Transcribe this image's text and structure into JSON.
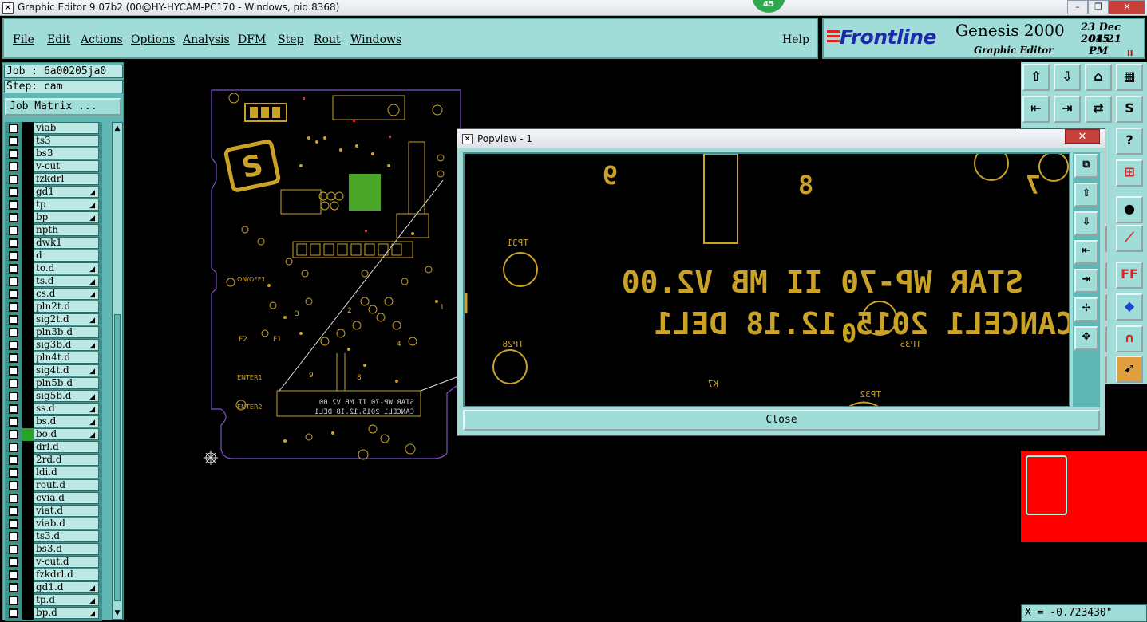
{
  "window": {
    "title": "Graphic Editor 9.07b2 (00@HY-HYCAM-PC170 - Windows, pid:8368)",
    "badge": "45",
    "minimize": "–",
    "maximize": "❐",
    "close": "✕"
  },
  "menu": {
    "items": [
      "File",
      "Edit",
      "Actions",
      "Options",
      "Analysis",
      "DFM",
      "Step",
      "Rout",
      "Windows"
    ],
    "help": "Help"
  },
  "brand": {
    "logo": "Frontline",
    "product": "Genesis 2000",
    "editor": "Graphic Editor",
    "date": "23 Dec 2015",
    "time": "04:21 PM",
    "pause": "II"
  },
  "left": {
    "job": "Job : 6a00205ja0",
    "step": "Step: cam",
    "job_matrix": "Job Matrix ..."
  },
  "layers": [
    {
      "name": "viab",
      "flag": ""
    },
    {
      "name": "ts3",
      "flag": ""
    },
    {
      "name": "bs3",
      "flag": ""
    },
    {
      "name": "v-cut",
      "flag": ""
    },
    {
      "name": "fzkdrl",
      "flag": ""
    },
    {
      "name": "gd1",
      "flag": "◢"
    },
    {
      "name": "tp",
      "flag": "◢"
    },
    {
      "name": "bp",
      "flag": "◢"
    },
    {
      "name": "npth",
      "flag": ""
    },
    {
      "name": "dwk1",
      "flag": ""
    },
    {
      "name": "d",
      "flag": ""
    },
    {
      "name": "to.d",
      "flag": "◢"
    },
    {
      "name": "ts.d",
      "flag": "◢"
    },
    {
      "name": "cs.d",
      "flag": "◢"
    },
    {
      "name": "pln2t.d",
      "flag": ""
    },
    {
      "name": "sig2t.d",
      "flag": "◢"
    },
    {
      "name": "pln3b.d",
      "flag": ""
    },
    {
      "name": "sig3b.d",
      "flag": "◢"
    },
    {
      "name": "pln4t.d",
      "flag": ""
    },
    {
      "name": "sig4t.d",
      "flag": "◢"
    },
    {
      "name": "pln5b.d",
      "flag": ""
    },
    {
      "name": "sig5b.d",
      "flag": "◢"
    },
    {
      "name": "ss.d",
      "flag": "◢"
    },
    {
      "name": "bs.d",
      "flag": "◢"
    },
    {
      "name": "bo.d",
      "flag": "◢"
    },
    {
      "name": "drl.d",
      "flag": ""
    },
    {
      "name": "2rd.d",
      "flag": ""
    },
    {
      "name": "ldi.d",
      "flag": ""
    },
    {
      "name": "rout.d",
      "flag": ""
    },
    {
      "name": "cvia.d",
      "flag": ""
    },
    {
      "name": "viat.d",
      "flag": ""
    },
    {
      "name": "viab.d",
      "flag": ""
    },
    {
      "name": "ts3.d",
      "flag": ""
    },
    {
      "name": "bs3.d",
      "flag": ""
    },
    {
      "name": "v-cut.d",
      "flag": ""
    },
    {
      "name": "fzkdrl.d",
      "flag": ""
    },
    {
      "name": "gd1.d",
      "flag": "◢"
    },
    {
      "name": "tp.d",
      "flag": "◢"
    },
    {
      "name": "bp.d",
      "flag": "◢"
    }
  ],
  "active_layer_index": 24,
  "board": {
    "silk_line1": "STAR WP-70 II MB V2.00",
    "silk_line2": "CANCEL1 2015.12.18 DEL1",
    "labels": [
      "9",
      "8",
      "7",
      "0",
      "TP31",
      "TP28",
      "TP35",
      "TP32",
      "K7",
      "ENTER1",
      "ENTER2",
      "F1",
      "F2",
      "ON/OFF1",
      "3",
      "2",
      "4",
      "1"
    ]
  },
  "popview": {
    "title": "Popview - 1",
    "close_x": "✕",
    "close_button": "Close"
  },
  "coord": "X = -0.723430\"",
  "colors": {
    "panel": "#a0dcd8",
    "gold": "#c9a227",
    "outline": "#7a52c8",
    "overview": "#ff0000"
  }
}
